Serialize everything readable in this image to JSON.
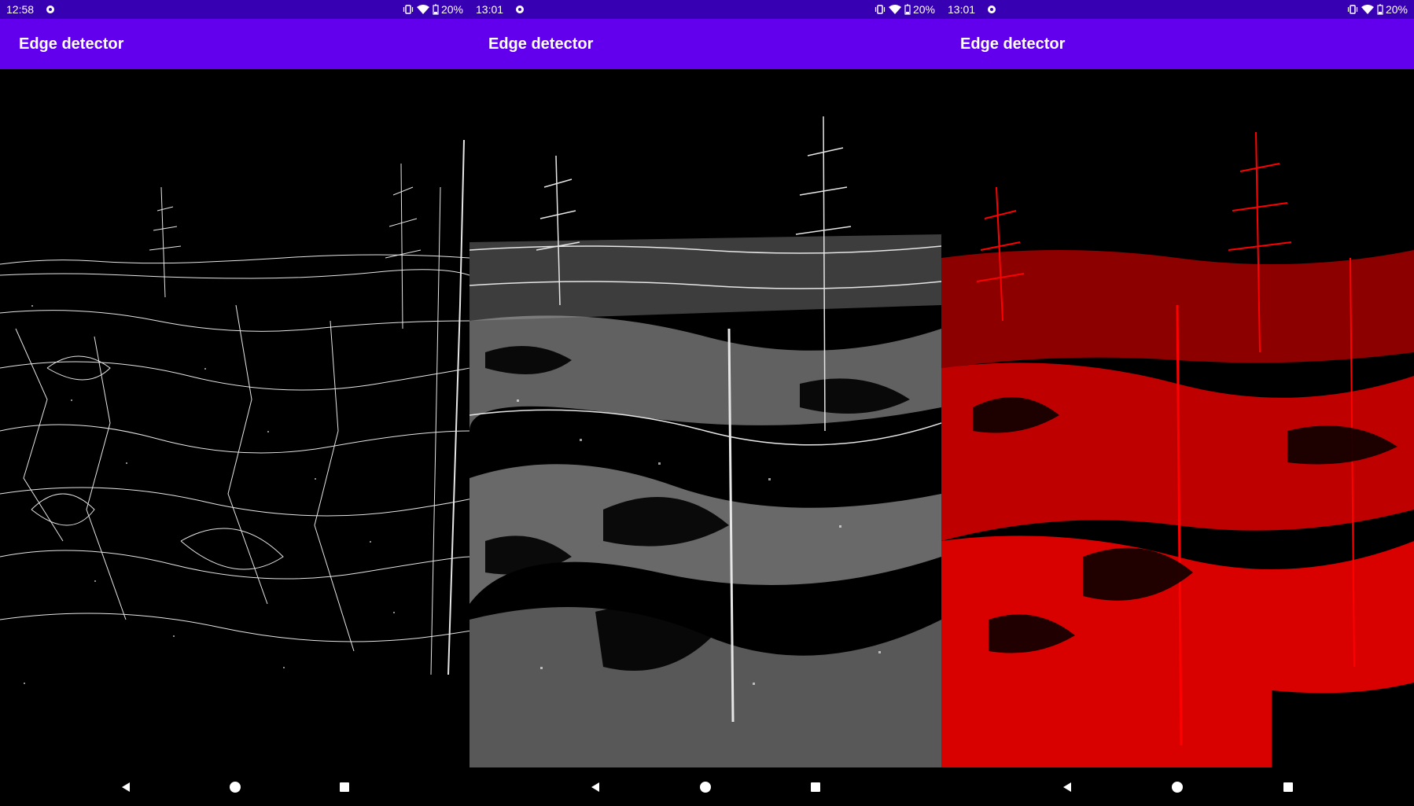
{
  "screens": [
    {
      "status": {
        "time": "12:58",
        "battery": "20%"
      },
      "app_title": "Edge detector",
      "edge_color": "#ffffff",
      "mode": "thin-edges"
    },
    {
      "status": {
        "time": "13:01",
        "battery": "20%"
      },
      "app_title": "Edge detector",
      "edge_color": "#e6e6e6",
      "mode": "grayscale-edges"
    },
    {
      "status": {
        "time": "13:01",
        "battery": "20%"
      },
      "app_title": "Edge detector",
      "edge_color": "#ff0000",
      "mode": "red-edges"
    }
  ],
  "icons": {
    "status_settings": "gear-icon",
    "status_vibrate": "vibrate-icon",
    "status_wifi": "wifi-icon",
    "status_battery": "battery-icon",
    "nav_back": "back-triangle-icon",
    "nav_home": "home-circle-icon",
    "nav_recents": "recents-square-icon"
  },
  "colors": {
    "status_bar": "#3700b3",
    "app_bar": "#6200ee",
    "background": "#000000"
  }
}
